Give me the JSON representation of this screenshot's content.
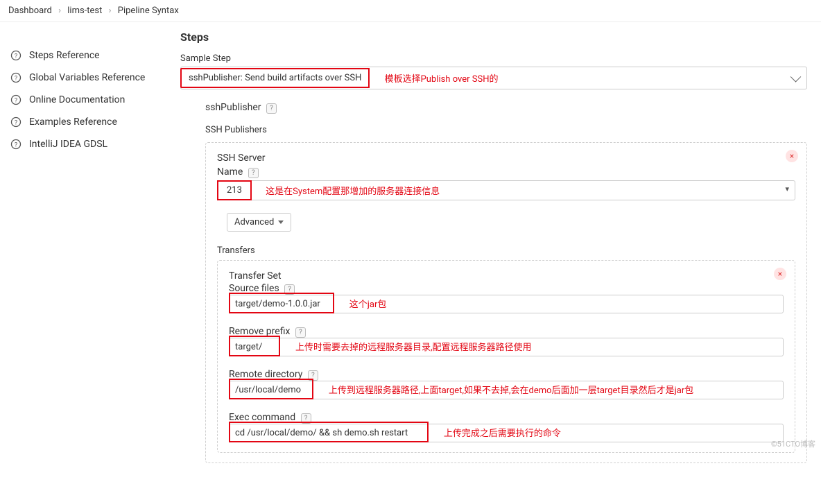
{
  "breadcrumb": {
    "a": "Dashboard",
    "b": "lims-test",
    "c": "Pipeline Syntax"
  },
  "sidebar": {
    "items": [
      {
        "label": "Steps Reference"
      },
      {
        "label": "Global Variables Reference"
      },
      {
        "label": "Online Documentation"
      },
      {
        "label": "Examples Reference"
      },
      {
        "label": "IntelliJ IDEA GDSL"
      }
    ]
  },
  "main": {
    "heading": "Steps",
    "sampleStepLabel": "Sample Step",
    "sampleStepValue": "sshPublisher: Send build artifacts over SSH",
    "ann_sample": "模板选择Publish over SSH的",
    "sshPublisherLabel": "sshPublisher",
    "sshPublishersTitle": "SSH Publishers",
    "sshServerTitle": "SSH Server",
    "nameLabel": "Name",
    "nameValue": "213",
    "ann_name": "这是在System配置那增加的服务器连接信息",
    "advancedLabel": "Advanced",
    "transfersTitle": "Transfers",
    "transferSetTitle": "Transfer Set",
    "sourceFilesLabel": "Source files",
    "sourceFilesValue": "target/demo-1.0.0.jar",
    "ann_source": "这个jar包",
    "removePrefixLabel": "Remove prefix",
    "removePrefixValue": "target/",
    "ann_removePrefix": "上传时需要去掉的远程服务器目录,配置远程服务器路径使用",
    "remoteDirLabel": "Remote directory",
    "remoteDirValue": "/usr/local/demo",
    "ann_remoteDir": "上传到远程服务器路径,上面target,如果不去掉,会在demo后面加一层target目录然后才是jar包",
    "execLabel": "Exec command",
    "execValue": "cd /usr/local/demo/ && sh demo.sh restart",
    "ann_exec": "上传完成之后需要执行的命令"
  },
  "watermark": "©51CTO博客"
}
